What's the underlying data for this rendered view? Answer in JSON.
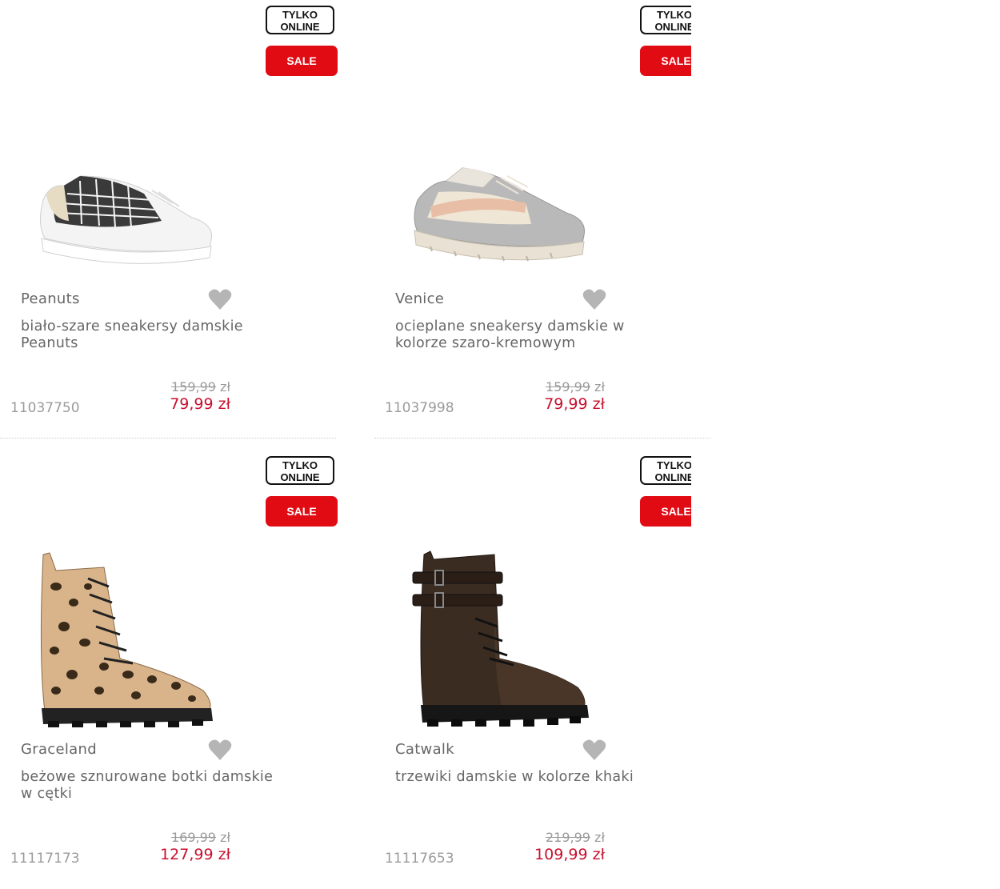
{
  "products": [
    {
      "badges": {
        "online_line1": "TYLKO",
        "online_line2": "ONLINE",
        "sale": "SALE"
      },
      "brand": "Peanuts",
      "title": "biało-szare sneakersy damskie Peanuts",
      "old_price": "159,99",
      "old_currency": "zł",
      "new_price": "79,99 zł",
      "sku": "11037750"
    },
    {
      "badges": {
        "online_line1": "TYLKO",
        "online_line2": "ONLINE",
        "sale": "SALE"
      },
      "brand": "Venice",
      "title": "ocieplane sneakersy damskie w kolorze szaro-kremowym",
      "old_price": "159,99",
      "old_currency": "zł",
      "new_price": "79,99 zł",
      "sku": "11037998"
    },
    {
      "badges": {
        "online_line1": "TYLKO",
        "online_line2": "ONLINE",
        "sale": "SALE"
      },
      "brand": "Graceland",
      "title": "beżowe sznurowane botki damskie w cętki",
      "old_price": "169,99",
      "old_currency": "zł",
      "new_price": "127,99 zł",
      "sku": "11117173"
    },
    {
      "badges": {
        "online_line1": "TYLKO",
        "online_line2": "ONLINE",
        "sale": "SALE"
      },
      "brand": "Catwalk",
      "title": "trzewiki damskie w kolorze khaki",
      "old_price": "219,99",
      "old_currency": "zł",
      "new_price": "109,99 zł",
      "sku": "11117653"
    }
  ],
  "colors": {
    "sale_red": "#e10b14",
    "price_red": "#c8102e",
    "heart_gray": "#b5b5b5"
  },
  "icons": {
    "wishlist": "heart-icon"
  }
}
